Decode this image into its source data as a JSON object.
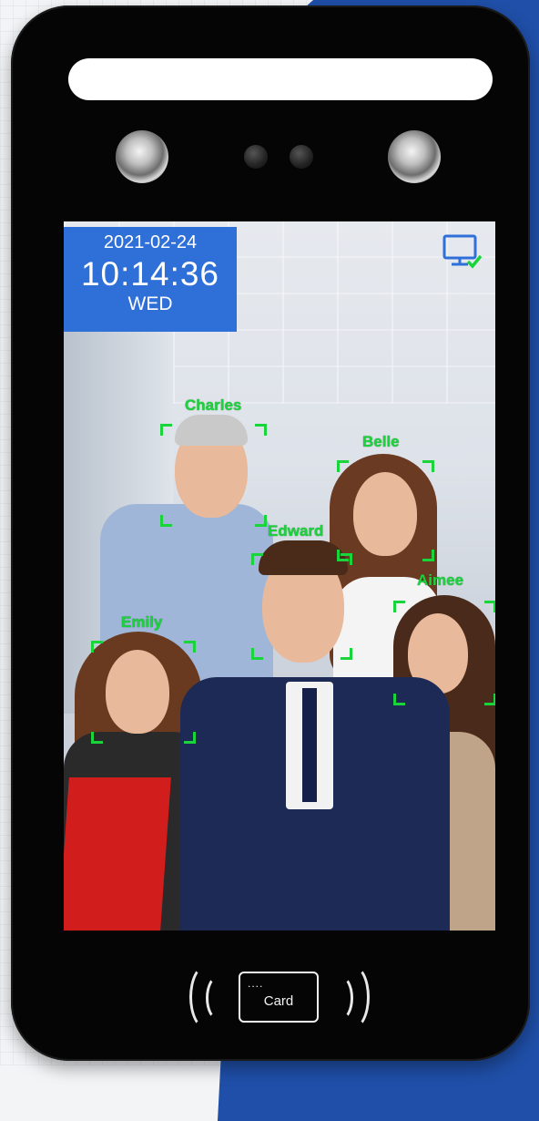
{
  "screen": {
    "date": "2021-02-24",
    "time": "10:14:36",
    "weekday": "WED",
    "status_icon": "monitor-check-icon",
    "faces": [
      {
        "name": "Charles"
      },
      {
        "name": "Belle"
      },
      {
        "name": "Edward"
      },
      {
        "name": "Aimee"
      },
      {
        "name": "Emily"
      }
    ]
  },
  "card_reader": {
    "label": "Card",
    "dots": "....",
    "icon": "card-reader-icon"
  },
  "colors": {
    "clock_bg": "#2e6fd8",
    "face_box": "#19d43a",
    "device_body": "#050505",
    "brand_blue": "#1f4fa8"
  }
}
